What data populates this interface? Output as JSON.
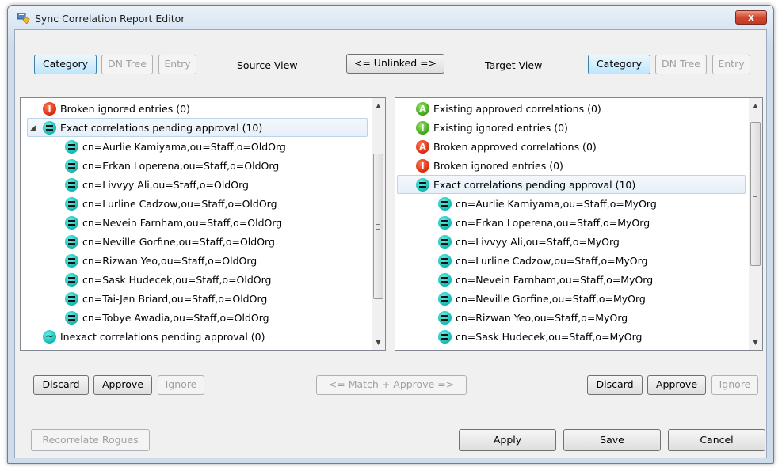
{
  "window": {
    "title": "Sync Correlation Report Editor",
    "close_glyph": "x",
    "accent": "#d2482f"
  },
  "top": {
    "source_view_label": "Source View",
    "target_view_label": "Target View",
    "unlinked_label": "<= Unlinked =>",
    "source_buttons": [
      "Category",
      "DN Tree",
      "Entry"
    ],
    "target_buttons": [
      "Category",
      "DN Tree",
      "Entry"
    ],
    "selected_view": "Category"
  },
  "source_tree": [
    {
      "icon": "I",
      "color": "red",
      "text": "Broken ignored entries (0)"
    },
    {
      "icon": "=",
      "color": "cyan",
      "text": "Exact correlations pending approval (10)",
      "expanded": true,
      "selected": true
    },
    {
      "icon": "=",
      "color": "cyan",
      "text": "cn=Aurlie Kamiyama,ou=Staff,o=OldOrg",
      "child": true
    },
    {
      "icon": "=",
      "color": "cyan",
      "text": "cn=Erkan Loperena,ou=Staff,o=OldOrg",
      "child": true
    },
    {
      "icon": "=",
      "color": "cyan",
      "text": "cn=Livvyy Ali,ou=Staff,o=OldOrg",
      "child": true
    },
    {
      "icon": "=",
      "color": "cyan",
      "text": "cn=Lurline Cadzow,ou=Staff,o=OldOrg",
      "child": true
    },
    {
      "icon": "=",
      "color": "cyan",
      "text": "cn=Nevein Farnham,ou=Staff,o=OldOrg",
      "child": true
    },
    {
      "icon": "=",
      "color": "cyan",
      "text": "cn=Neville Gorfine,ou=Staff,o=OldOrg",
      "child": true
    },
    {
      "icon": "=",
      "color": "cyan",
      "text": "cn=Rizwan Yeo,ou=Staff,o=OldOrg",
      "child": true
    },
    {
      "icon": "=",
      "color": "cyan",
      "text": "cn=Sask Hudecek,ou=Staff,o=OldOrg",
      "child": true
    },
    {
      "icon": "=",
      "color": "cyan",
      "text": "cn=Tai-Jen Briard,ou=Staff,o=OldOrg",
      "child": true
    },
    {
      "icon": "=",
      "color": "cyan",
      "text": "cn=Tobye Awadia,ou=Staff,o=OldOrg",
      "child": true
    },
    {
      "icon": "~",
      "color": "cyan",
      "text": "Inexact correlations pending approval (0)"
    }
  ],
  "target_tree": [
    {
      "icon": "A",
      "color": "green",
      "text": "Existing approved correlations (0)"
    },
    {
      "icon": "I",
      "color": "green",
      "text": "Existing ignored entries (0)"
    },
    {
      "icon": "A",
      "color": "red",
      "text": "Broken approved correlations (0)"
    },
    {
      "icon": "I",
      "color": "red",
      "text": "Broken ignored entries (0)"
    },
    {
      "icon": "=",
      "color": "cyan",
      "text": "Exact correlations pending approval (10)",
      "selected": true
    },
    {
      "icon": "=",
      "color": "cyan",
      "text": "cn=Aurlie Kamiyama,ou=Staff,o=MyOrg",
      "child": true
    },
    {
      "icon": "=",
      "color": "cyan",
      "text": "cn=Erkan Loperena,ou=Staff,o=MyOrg",
      "child": true
    },
    {
      "icon": "=",
      "color": "cyan",
      "text": "cn=Livvyy Ali,ou=Staff,o=MyOrg",
      "child": true
    },
    {
      "icon": "=",
      "color": "cyan",
      "text": "cn=Lurline Cadzow,ou=Staff,o=MyOrg",
      "child": true
    },
    {
      "icon": "=",
      "color": "cyan",
      "text": "cn=Nevein Farnham,ou=Staff,o=MyOrg",
      "child": true
    },
    {
      "icon": "=",
      "color": "cyan",
      "text": "cn=Neville Gorfine,ou=Staff,o=MyOrg",
      "child": true
    },
    {
      "icon": "=",
      "color": "cyan",
      "text": "cn=Rizwan Yeo,ou=Staff,o=MyOrg",
      "child": true
    },
    {
      "icon": "=",
      "color": "cyan",
      "text": "cn=Sask Hudecek,ou=Staff,o=MyOrg",
      "child": true
    }
  ],
  "actions": {
    "discard": "Discard",
    "approve": "Approve",
    "ignore": "Ignore",
    "match_approve": "<= Match + Approve =>",
    "recorrelate": "Recorrelate Rogues",
    "apply": "Apply",
    "save": "Save",
    "cancel": "Cancel"
  }
}
